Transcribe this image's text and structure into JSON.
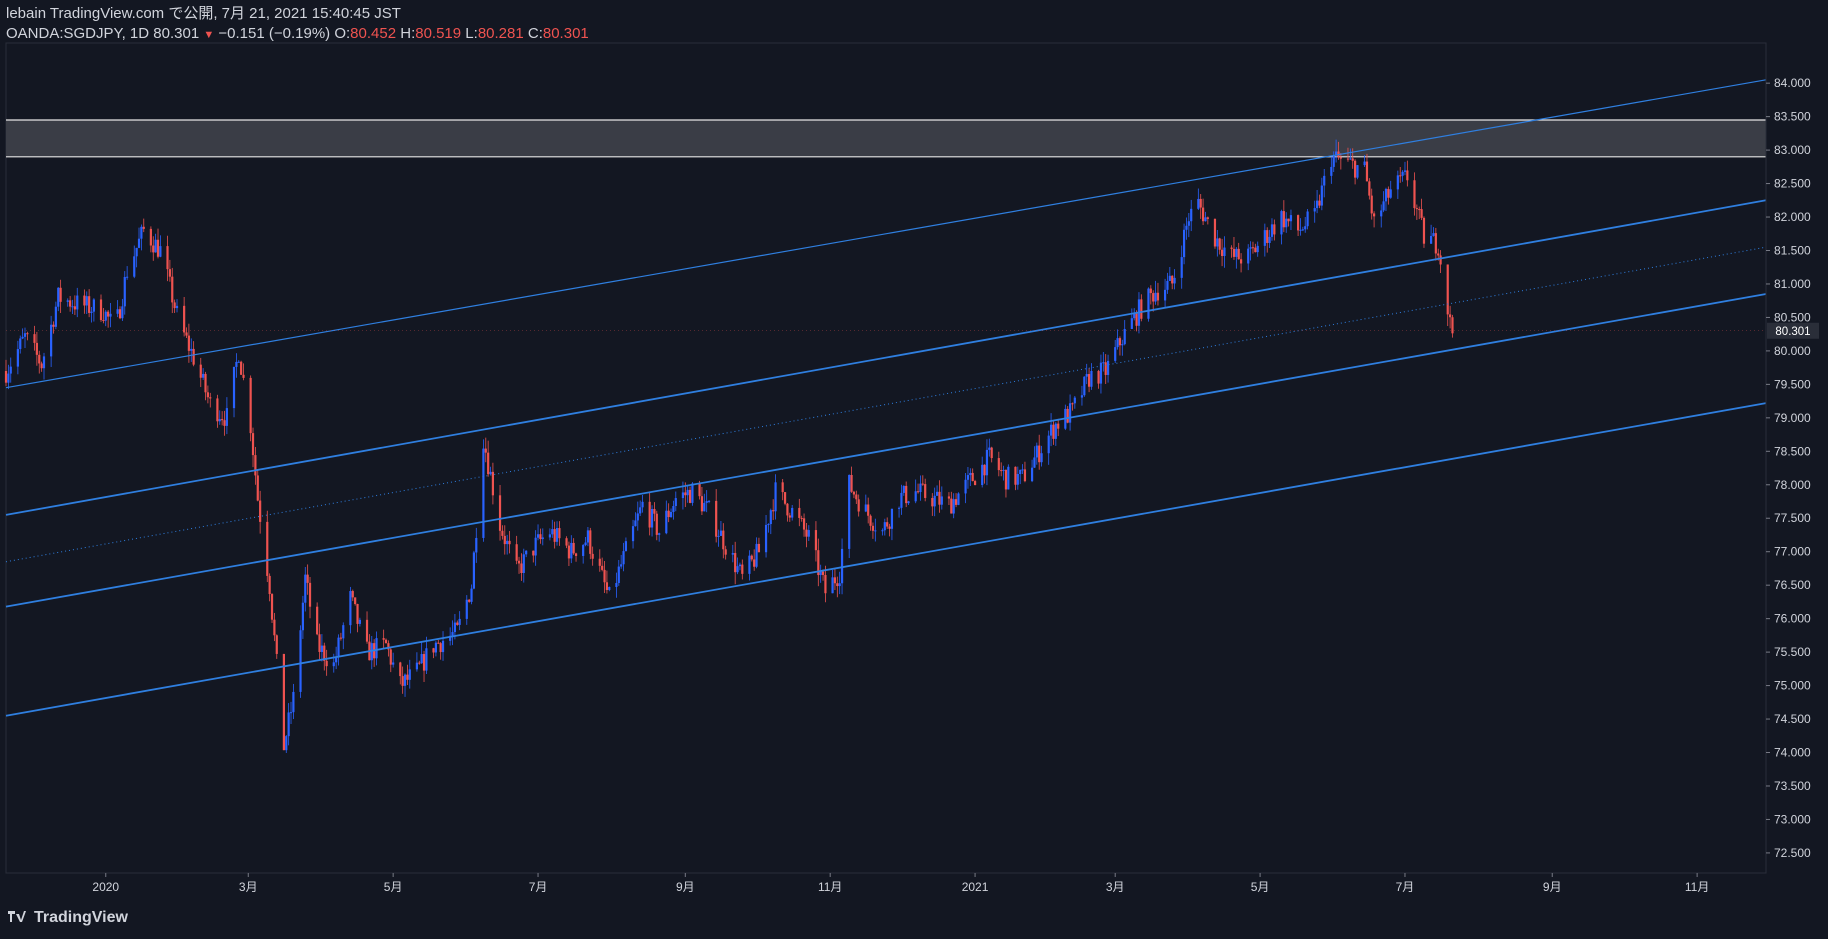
{
  "header": {
    "publisher_line": "lebain TradingView.com で公開, 7月 21, 2021 15:40:45 JST",
    "symbol": "OANDA:SGDJPY, 1D",
    "last": "80.301",
    "change": "−0.151 (−0.19%)",
    "o_label": "O:",
    "o_value": "80.452",
    "h_label": "H:",
    "h_value": "80.519",
    "l_label": "L:",
    "l_value": "80.281",
    "c_label": "C:",
    "c_value": "80.301"
  },
  "footer": {
    "brand": "TradingView"
  },
  "colors": {
    "background": "#131722",
    "up": "#2962ff",
    "down": "#ef5350",
    "channel": "#2f7fe0",
    "zone": "#3a3d46",
    "zone_border": "#e6e6e6",
    "axis_text": "#d1d4dc"
  },
  "chart_data": {
    "type": "candlestick",
    "symbol": "OANDA:SGDJPY",
    "interval": "1D",
    "ylim": [
      72.2,
      84.6
    ],
    "y_ticks": [
      "84.000",
      "83.500",
      "83.000",
      "82.500",
      "82.000",
      "81.500",
      "81.000",
      "80.500",
      "80.000",
      "79.500",
      "79.000",
      "78.500",
      "78.000",
      "77.500",
      "77.000",
      "76.500",
      "76.000",
      "75.500",
      "75.000",
      "74.500",
      "74.000",
      "73.500",
      "73.000",
      "72.500"
    ],
    "last_price_label": "80.301",
    "x_start": "2019-11-20",
    "x_end": "2021-11-30",
    "x_ticks": [
      {
        "date": "2020-01-01",
        "label": "2020"
      },
      {
        "date": "2020-03-01",
        "label": "3月"
      },
      {
        "date": "2020-05-01",
        "label": "5月"
      },
      {
        "date": "2020-07-01",
        "label": "7月"
      },
      {
        "date": "2020-09-01",
        "label": "9月"
      },
      {
        "date": "2020-11-01",
        "label": "11月"
      },
      {
        "date": "2021-01-01",
        "label": "2021"
      },
      {
        "date": "2021-03-01",
        "label": "3月"
      },
      {
        "date": "2021-05-01",
        "label": "5月"
      },
      {
        "date": "2021-07-01",
        "label": "7月"
      },
      {
        "date": "2021-09-01",
        "label": "9月"
      },
      {
        "date": "2021-11-01",
        "label": "11月"
      }
    ],
    "price_path": [
      [
        "2019-11-20",
        79.7
      ],
      [
        "2019-11-28",
        80.2
      ],
      [
        "2019-12-05",
        79.8
      ],
      [
        "2019-12-12",
        80.8
      ],
      [
        "2019-12-20",
        80.7
      ],
      [
        "2019-12-31",
        80.6
      ],
      [
        "2020-01-05",
        80.3
      ],
      [
        "2020-01-10",
        81.2
      ],
      [
        "2020-01-17",
        81.8
      ],
      [
        "2020-01-24",
        81.5
      ],
      [
        "2020-02-01",
        80.4
      ],
      [
        "2020-02-07",
        79.9
      ],
      [
        "2020-02-14",
        79.2
      ],
      [
        "2020-02-21",
        79.0
      ],
      [
        "2020-02-26",
        80.0
      ],
      [
        "2020-03-02",
        78.9
      ],
      [
        "2020-03-05",
        77.8
      ],
      [
        "2020-03-10",
        76.5
      ],
      [
        "2020-03-16",
        74.1
      ],
      [
        "2020-03-20",
        74.8
      ],
      [
        "2020-03-25",
        76.6
      ],
      [
        "2020-03-30",
        75.6
      ],
      [
        "2020-04-06",
        75.3
      ],
      [
        "2020-04-13",
        76.3
      ],
      [
        "2020-04-20",
        75.5
      ],
      [
        "2020-04-28",
        75.6
      ],
      [
        "2020-05-04",
        75.0
      ],
      [
        "2020-05-11",
        75.2
      ],
      [
        "2020-05-18",
        75.6
      ],
      [
        "2020-05-28",
        75.8
      ],
      [
        "2020-06-03",
        76.5
      ],
      [
        "2020-06-08",
        78.7
      ],
      [
        "2020-06-15",
        77.4
      ],
      [
        "2020-06-22",
        76.7
      ],
      [
        "2020-06-30",
        77.1
      ],
      [
        "2020-07-06",
        77.3
      ],
      [
        "2020-07-15",
        77.0
      ],
      [
        "2020-07-22",
        77.2
      ],
      [
        "2020-07-31",
        76.3
      ],
      [
        "2020-08-07",
        77.0
      ],
      [
        "2020-08-14",
        77.7
      ],
      [
        "2020-08-21",
        77.3
      ],
      [
        "2020-08-28",
        77.8
      ],
      [
        "2020-09-04",
        77.9
      ],
      [
        "2020-09-11",
        77.6
      ],
      [
        "2020-09-18",
        77.1
      ],
      [
        "2020-09-25",
        76.6
      ],
      [
        "2020-10-02",
        77.0
      ],
      [
        "2020-10-09",
        77.9
      ],
      [
        "2020-10-16",
        77.6
      ],
      [
        "2020-10-23",
        77.2
      ],
      [
        "2020-10-30",
        76.4
      ],
      [
        "2020-11-05",
        76.7
      ],
      [
        "2020-11-09",
        78.0
      ],
      [
        "2020-11-16",
        77.6
      ],
      [
        "2020-11-23",
        77.3
      ],
      [
        "2020-11-30",
        77.8
      ],
      [
        "2020-12-07",
        77.9
      ],
      [
        "2020-12-14",
        77.8
      ],
      [
        "2020-12-21",
        77.7
      ],
      [
        "2020-12-31",
        78.1
      ],
      [
        "2021-01-07",
        78.4
      ],
      [
        "2021-01-14",
        78.1
      ],
      [
        "2021-01-21",
        78.1
      ],
      [
        "2021-01-28",
        78.5
      ],
      [
        "2021-02-04",
        78.9
      ],
      [
        "2021-02-11",
        79.1
      ],
      [
        "2021-02-18",
        79.6
      ],
      [
        "2021-02-25",
        79.7
      ],
      [
        "2021-03-04",
        80.2
      ],
      [
        "2021-03-11",
        80.6
      ],
      [
        "2021-03-18",
        80.9
      ],
      [
        "2021-03-25",
        81.0
      ],
      [
        "2021-04-01",
        82.0
      ],
      [
        "2021-04-05",
        82.2
      ],
      [
        "2021-04-12",
        81.7
      ],
      [
        "2021-04-19",
        81.4
      ],
      [
        "2021-04-26",
        81.4
      ],
      [
        "2021-05-03",
        81.7
      ],
      [
        "2021-05-10",
        82.0
      ],
      [
        "2021-05-17",
        81.8
      ],
      [
        "2021-05-24",
        82.0
      ],
      [
        "2021-05-31",
        82.9
      ],
      [
        "2021-06-07",
        82.8
      ],
      [
        "2021-06-14",
        82.7
      ],
      [
        "2021-06-18",
        81.9
      ],
      [
        "2021-06-25",
        82.4
      ],
      [
        "2021-07-02",
        82.6
      ],
      [
        "2021-07-09",
        81.7
      ],
      [
        "2021-07-15",
        81.6
      ],
      [
        "2021-07-20",
        80.4
      ],
      [
        "2021-07-21",
        80.3
      ]
    ],
    "zone": {
      "from": 82.9,
      "to": 83.45
    },
    "trendlines": [
      {
        "p1": [
          "2019-11-20",
          79.45
        ],
        "p2": [
          "2021-11-30",
          84.05
        ],
        "width": 1.2
      },
      {
        "p1": [
          "2019-11-20",
          77.55
        ],
        "p2": [
          "2021-11-30",
          82.25
        ],
        "width": 1.8
      },
      {
        "p1": [
          "2019-11-20",
          76.85
        ],
        "p2": [
          "2021-11-30",
          81.55
        ],
        "width": 1,
        "dotted": true
      },
      {
        "p1": [
          "2019-11-20",
          76.18
        ],
        "p2": [
          "2021-11-30",
          80.85
        ],
        "width": 1.8
      },
      {
        "p1": [
          "2019-11-20",
          74.55
        ],
        "p2": [
          "2021-11-30",
          79.22
        ],
        "width": 1.8
      }
    ]
  }
}
